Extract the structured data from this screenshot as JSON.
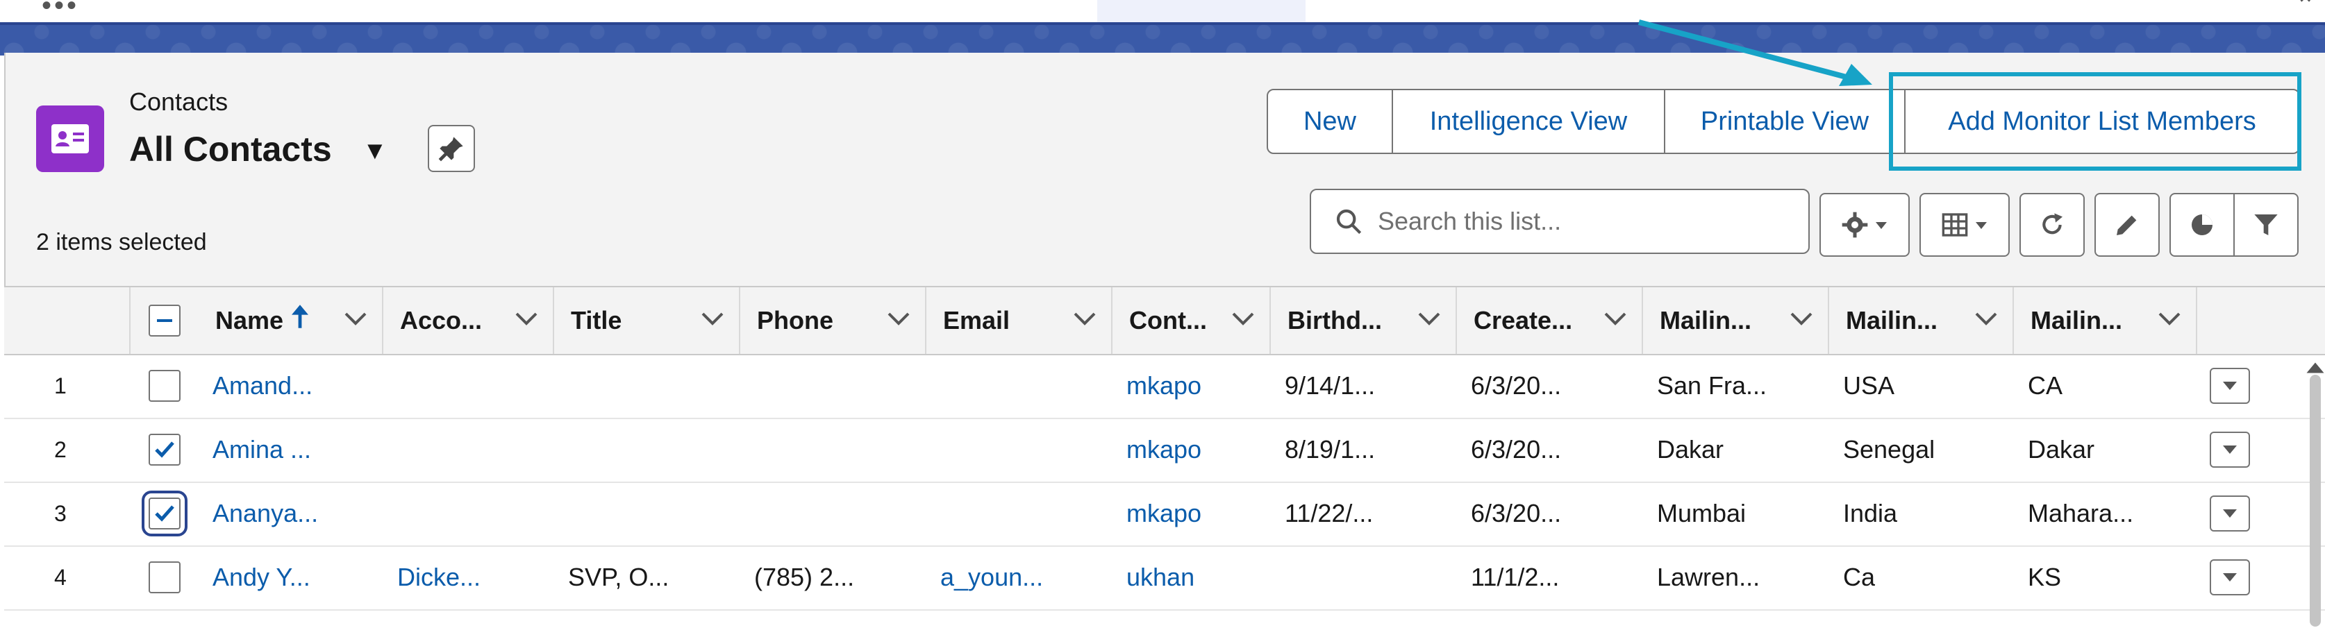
{
  "header": {
    "object_label": "Contacts",
    "list_view_name": "All Contacts",
    "selected_count": "2 items selected"
  },
  "actions": {
    "new": "New",
    "intelligence_view": "Intelligence View",
    "printable_view": "Printable View",
    "add_monitor": "Add Monitor List Members"
  },
  "search": {
    "placeholder": "Search this list..."
  },
  "columns": [
    "Name",
    "Acco...",
    "Title",
    "Phone",
    "Email",
    "Cont...",
    "Birthd...",
    "Create...",
    "Mailin...",
    "Mailin...",
    "Mailin..."
  ],
  "rows": [
    {
      "num": "1",
      "checked": false,
      "name": "Amand...",
      "account": "",
      "title": "",
      "phone": "",
      "email": "",
      "owner": "mkapo",
      "birthdate": "9/14/1...",
      "created": "6/3/20...",
      "city": "San Fra...",
      "country": "USA",
      "state": "CA"
    },
    {
      "num": "2",
      "checked": true,
      "name": "Amina ...",
      "account": "",
      "title": "",
      "phone": "",
      "email": "",
      "owner": "mkapo",
      "birthdate": "8/19/1...",
      "created": "6/3/20...",
      "city": "Dakar",
      "country": "Senegal",
      "state": "Dakar"
    },
    {
      "num": "3",
      "checked": true,
      "name": "Ananya...",
      "account": "",
      "title": "",
      "phone": "",
      "email": "",
      "owner": "mkapo",
      "birthdate": "11/22/...",
      "created": "6/3/20...",
      "city": "Mumbai",
      "country": "India",
      "state": "Mahara..."
    },
    {
      "num": "4",
      "checked": false,
      "name": "Andy Y...",
      "account": "Dicke...",
      "title": "SVP, O...",
      "phone": "(785) 2...",
      "email": "a_youn...",
      "owner": "ukhan",
      "birthdate": "",
      "created": "11/1/2...",
      "city": "Lawren...",
      "country": "Ca",
      "state": "KS"
    }
  ],
  "colors": {
    "accent": "#0b5cab",
    "highlight": "#17a3c7",
    "object_icon": "#8e30c9",
    "band": "#3a5aa8"
  },
  "icons": [
    "contact-card-icon",
    "pin-icon",
    "search-icon",
    "gear-icon",
    "table-icon",
    "refresh-icon",
    "pencil-icon",
    "pie-chart-icon",
    "filter-icon",
    "chevron-down-icon",
    "sort-up-icon",
    "checkbox-check-icon"
  ]
}
